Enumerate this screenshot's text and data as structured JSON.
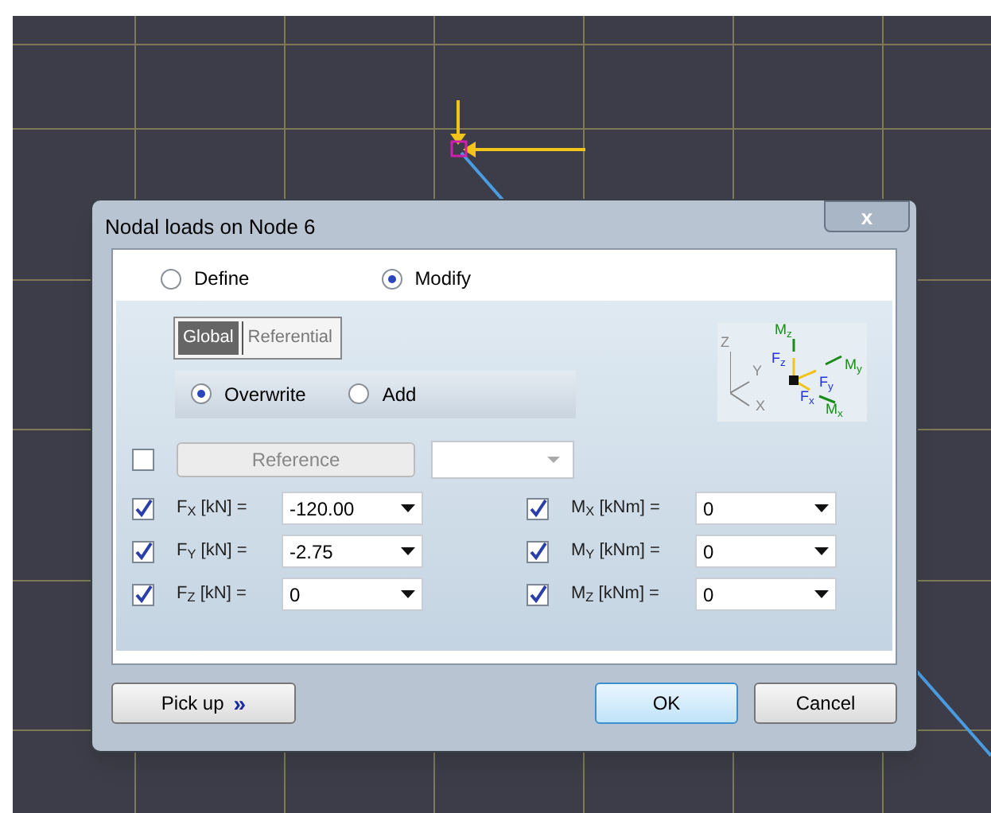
{
  "dialog": {
    "title": "Nodal loads on Node 6",
    "close": "x"
  },
  "mode_options": [
    {
      "label": "Define",
      "selected": false
    },
    {
      "label": "Modify",
      "selected": true
    }
  ],
  "tabs": [
    {
      "label": "Global",
      "selected": true
    },
    {
      "label": "Referential",
      "selected": false
    }
  ],
  "action_options": [
    {
      "label": "Overwrite",
      "selected": true
    },
    {
      "label": "Add",
      "selected": false
    }
  ],
  "axes_diagram": {
    "labels": [
      "Z",
      "Y",
      "X",
      "M$_{z}$",
      "F$_{z}$",
      "F$_{y}$",
      "M$_{y}$",
      "F$_{x}$",
      "M$_{x}$"
    ]
  },
  "reference": {
    "checked": false,
    "button": "Reference",
    "disabled": true
  },
  "forces": [
    {
      "label": "F$_{X}$ [kN] =",
      "value": "-120.00",
      "checked": true
    },
    {
      "label": "F$_{Y}$ [kN] =",
      "value": "-2.75",
      "checked": true
    },
    {
      "label": "F$_{Z}$ [kN] =",
      "value": "0",
      "checked": true
    }
  ],
  "moments": [
    {
      "label": "M$_{X}$ [kNm] =",
      "value": "0",
      "checked": true
    },
    {
      "label": "M$_{Y}$ [kNm] =",
      "value": "0",
      "checked": true
    },
    {
      "label": "M$_{Z}$ [kNm] =",
      "value": "0",
      "checked": true
    }
  ],
  "footer": {
    "pick_up": "Pick up",
    "pick_up_icon": "»",
    "ok": "OK",
    "cancel": "Cancel"
  }
}
